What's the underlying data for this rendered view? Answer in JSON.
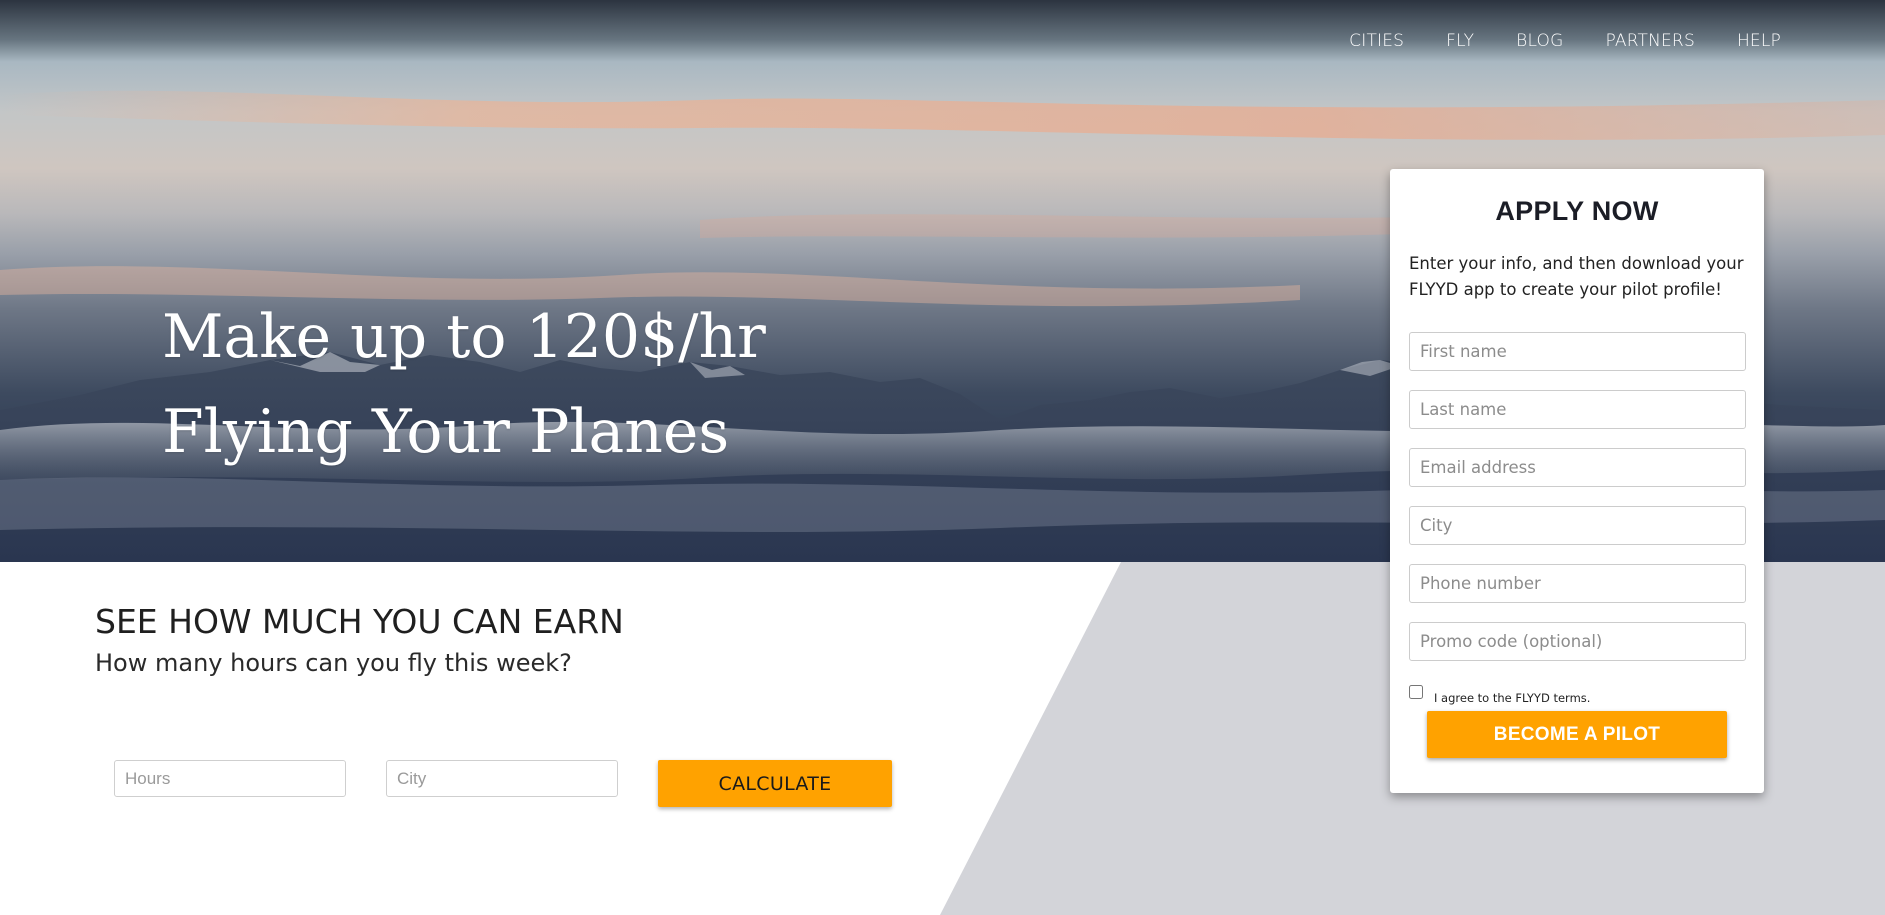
{
  "nav": {
    "links": [
      "CITIES",
      "FLY",
      "BLOG",
      "PARTNERS",
      "HELP"
    ]
  },
  "hero": {
    "line1": "Make up to 120$/hr",
    "line2": "Flying Your Planes"
  },
  "earn": {
    "heading": "SEE HOW MUCH YOU CAN EARN",
    "subheading": "How many hours can you fly this week?",
    "hours_placeholder": "Hours",
    "city_placeholder": "City",
    "calculate_label": "CALCULATE"
  },
  "apply": {
    "title": "APPLY NOW",
    "intro": "Enter your info, and then download your FLYYD app to create your pilot profile!",
    "fields": {
      "first_name": "First name",
      "last_name": "Last name",
      "email": "Email address",
      "city": "City",
      "phone": "Phone number",
      "promo": "Promo code (optional)"
    },
    "terms_label": "I agree to the FLYYD terms.",
    "terms_checked": false,
    "submit_label": "BECOME A PILOT"
  },
  "colors": {
    "accent": "#ffa200",
    "panel_gray": "#d3d4d9",
    "heading_dark": "#1b1d26"
  }
}
